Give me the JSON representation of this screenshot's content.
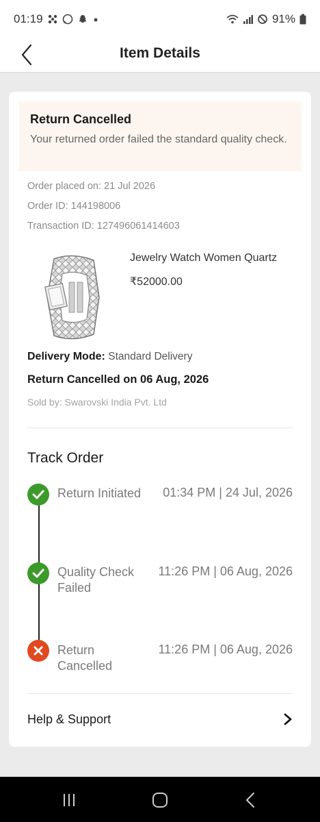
{
  "status_bar": {
    "time": "01:19",
    "battery": "91%",
    "notification_icons": [
      "pinwheel-icon",
      "whatsapp-icon",
      "snapchat-icon",
      "dot-icon"
    ],
    "system_icons": [
      "wifi-icon",
      "signal-icon",
      "dnd-icon",
      "battery-icon"
    ]
  },
  "header": {
    "title": "Item Details",
    "back_icon": "chevron-left-icon"
  },
  "banner": {
    "title": "Return Cancelled",
    "message": "Your returned order failed the standard quality check."
  },
  "order": {
    "placed_on": "Order placed on: 21 Jul 2026",
    "order_id": "Order ID: 144198006",
    "transaction_id": "Transaction ID: 127496061414603"
  },
  "product": {
    "name": "Jewelry Watch Women Quartz",
    "price": "₹52000.00",
    "image_icon": "watch-icon"
  },
  "delivery": {
    "mode_label": "Delivery Mode:",
    "mode_value": "Standard Delivery",
    "return_status": "Return Cancelled on 06 Aug, 2026",
    "sold_by": "Sold by: Swarovski India Pvt. Ltd"
  },
  "track": {
    "title": "Track Order",
    "steps": [
      {
        "label": "Return Initiated",
        "time": "01:34 PM | 24 Jul, 2026",
        "status": "done"
      },
      {
        "label": "Quality Check Failed",
        "time": "11:26 PM | 06 Aug, 2026",
        "status": "done"
      },
      {
        "label": "Return Cancelled",
        "time": "11:26 PM | 06 Aug, 2026",
        "status": "failed"
      }
    ]
  },
  "help": {
    "label": "Help & Support",
    "icon": "chevron-right-icon"
  },
  "colors": {
    "success": "#3c9a2a",
    "error": "#e04a1e",
    "banner_bg": "#fdf6f0"
  }
}
